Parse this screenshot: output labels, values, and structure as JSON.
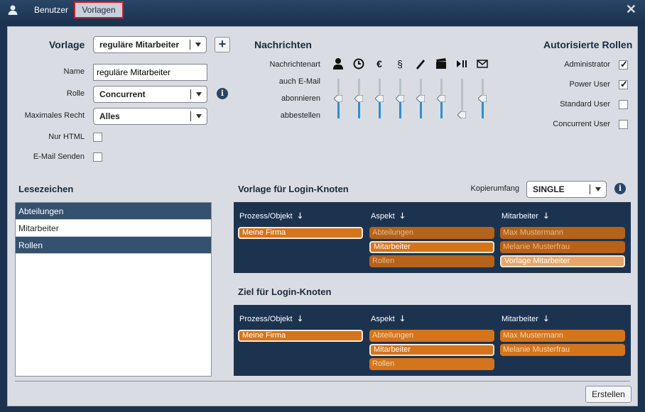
{
  "tabs": {
    "benutzer": "Benutzer",
    "vorlagen": "Vorlagen"
  },
  "form": {
    "vorlage_label": "Vorlage",
    "vorlage_value": "reguläre Mitarbeiter",
    "name_label": "Name",
    "name_value": "reguläre Mitarbeiter",
    "rolle_label": "Rolle",
    "rolle_value": "Concurrent",
    "max_label": "Maximales Recht",
    "max_value": "Alles",
    "nur_html_label": "Nur HTML",
    "email_label": "E-Mail Senden"
  },
  "nachrichten": {
    "title": "Nachrichten",
    "row_labels": [
      "Nachrichtenart",
      "auch E-Mail",
      "abonnieren",
      "abbestellen"
    ],
    "icons": [
      "person-icon",
      "clock-icon",
      "euro-icon",
      "paragraph-icon",
      "pen-icon",
      "clapper-icon",
      "play-pause-icon",
      "mail-icon"
    ],
    "sliders": [
      {
        "name": "person",
        "level": 0.5
      },
      {
        "name": "clock",
        "level": 0.5
      },
      {
        "name": "euro",
        "level": 0.5
      },
      {
        "name": "paragraph",
        "level": 0.5
      },
      {
        "name": "pen",
        "level": 0.5
      },
      {
        "name": "clapper",
        "level": 0.5
      },
      {
        "name": "play-pause",
        "level": 0.0
      },
      {
        "name": "mail",
        "level": 0.5
      }
    ]
  },
  "rollen": {
    "title": "Autorisierte Rollen",
    "items": [
      {
        "label": "Administrator",
        "checked": true
      },
      {
        "label": "Power User",
        "checked": true
      },
      {
        "label": "Standard User",
        "checked": false
      },
      {
        "label": "Concurrent User",
        "checked": false
      }
    ]
  },
  "lesezeichen": {
    "title": "Lesezeichen",
    "items": [
      "Abteilungen",
      "Mitarbeiter",
      "Rollen"
    ]
  },
  "vorlage_login": {
    "title": "Vorlage für Login-Knoten",
    "kopier_label": "Kopierumfang",
    "kopier_value": "SINGLE",
    "headers": [
      "Prozess/Objekt",
      "Aspekt",
      "Mitarbeiter"
    ],
    "col1": [
      "Meine Firma"
    ],
    "col2": [
      "Abteilungen",
      "Mitarbeiter",
      "Rollen"
    ],
    "col3": [
      "Max Mustermann",
      "Melanie Musterfrau",
      "Vorlage Mitarbeiter"
    ]
  },
  "ziel_login": {
    "title": "Ziel für Login-Knoten",
    "headers": [
      "Prozess/Objekt",
      "Aspekt",
      "Mitarbeiter"
    ],
    "col1": [
      "Meine Firma"
    ],
    "col2": [
      "Abteilungen",
      "Mitarbeiter",
      "Rollen"
    ],
    "col3": [
      "Max Mustermann",
      "Melanie Musterfrau"
    ]
  },
  "footer": {
    "erstellen": "Erstellen"
  },
  "colors": {
    "accent": "#d4741c",
    "navy": "#1c3350",
    "slider": "#2d8fd5",
    "highlight": "#d01f24"
  }
}
